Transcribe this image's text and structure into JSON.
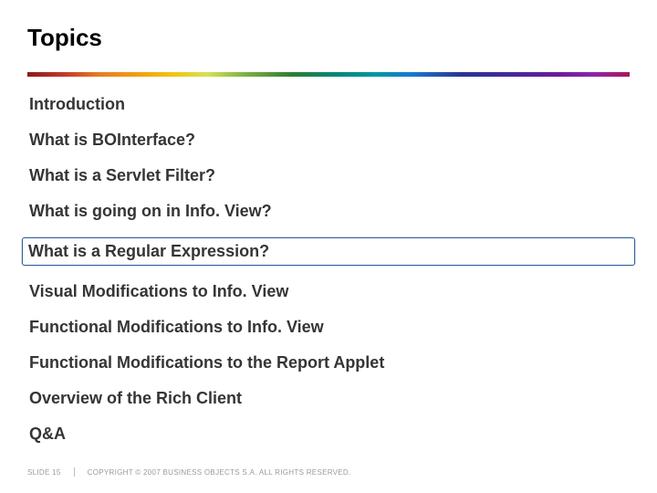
{
  "title": "Topics",
  "topics": [
    {
      "label": "Introduction",
      "highlighted": false
    },
    {
      "label": "What is BOInterface?",
      "highlighted": false
    },
    {
      "label": "What is a Servlet Filter?",
      "highlighted": false
    },
    {
      "label": "What is going on in Info. View?",
      "highlighted": false
    },
    {
      "label": "What is a Regular Expression?",
      "highlighted": true
    },
    {
      "label": "Visual Modifications to Info. View",
      "highlighted": false
    },
    {
      "label": "Functional Modifications to Info. View",
      "highlighted": false
    },
    {
      "label": "Functional Modifications to the Report Applet",
      "highlighted": false
    },
    {
      "label": "Overview of the Rich Client",
      "highlighted": false
    },
    {
      "label": "Q&A",
      "highlighted": false
    }
  ],
  "footer": {
    "slide_label": "SLIDE 15",
    "copyright": "COPYRIGHT © 2007 BUSINESS OBJECTS S.A. ALL RIGHTS RESERVED."
  }
}
